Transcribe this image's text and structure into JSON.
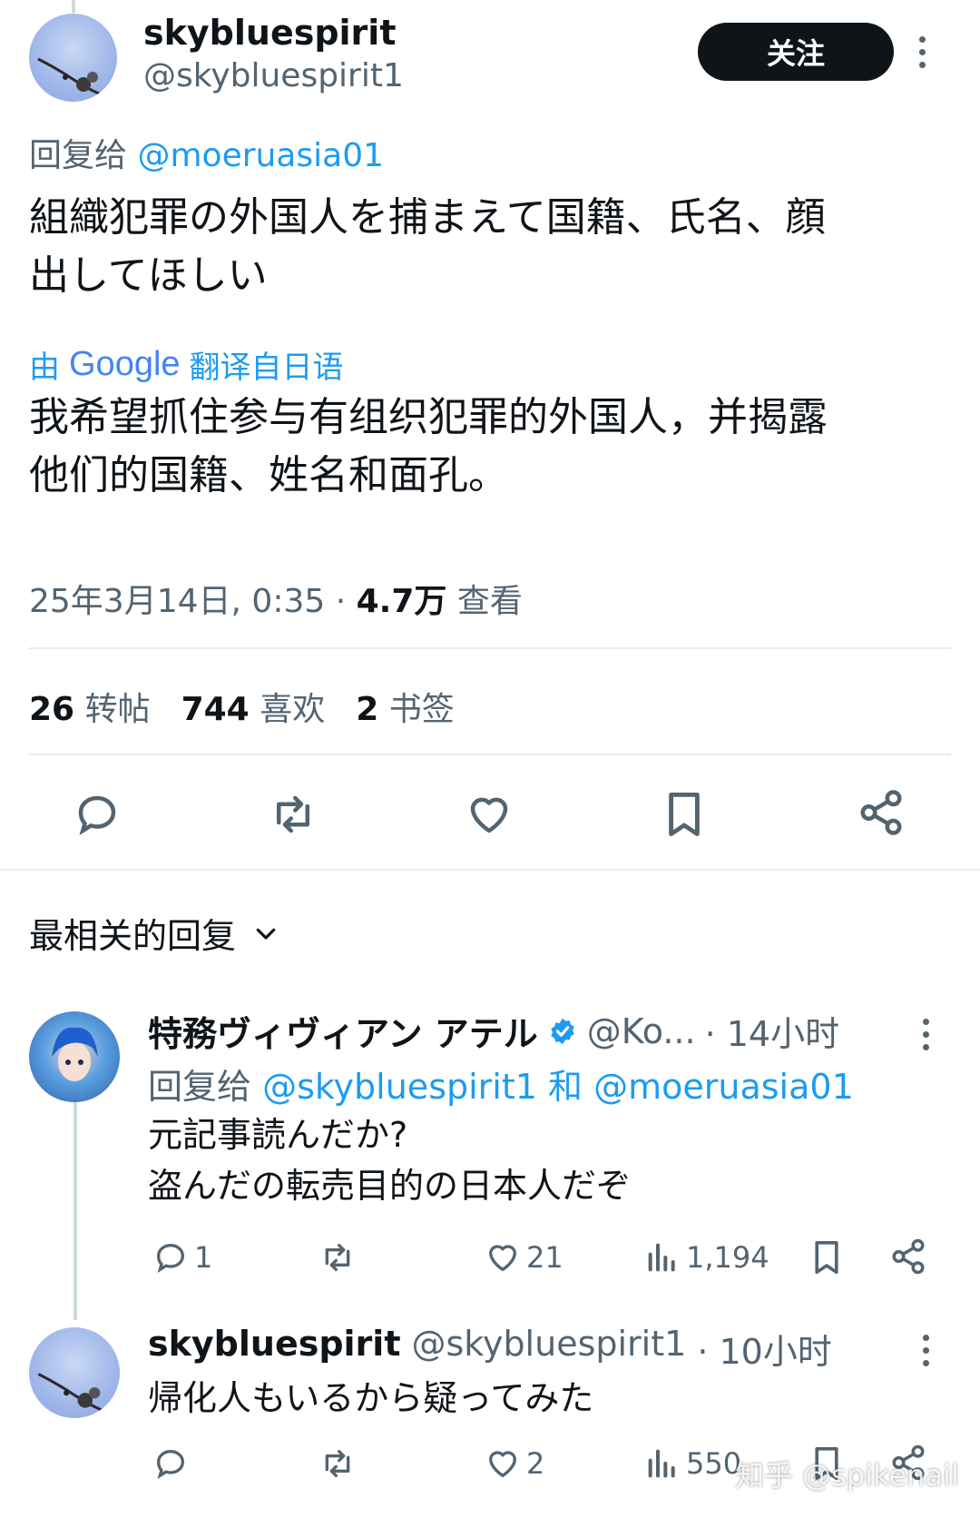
{
  "tweet": {
    "display_name": "skybluespirit",
    "handle": "@skybluespirit1",
    "follow_label": "关注",
    "reply_to_prefix": "回复给",
    "reply_to_handle": "@moeruasia01",
    "text_line1": "組織犯罪の外国人を捕まえて国籍、氏名、顔",
    "text_line2": "出してほしい",
    "translated_by_prefix": "由",
    "translated_by_brand": "Google",
    "translated_by_suffix": "翻译自日语",
    "translation_line1": "我希望抓住参与有组织犯罪的外国人，并揭露",
    "translation_line2": "他们的国籍、姓名和面孔。",
    "timestamp": "25年3月14日, 0:35 · ",
    "views_count": "4.7万",
    "views_label": " 查看",
    "stats": {
      "retweets_count": "26",
      "retweets_label": "转帖",
      "likes_count": "744",
      "likes_label": "喜欢",
      "bookmarks_count": "2",
      "bookmarks_label": "书签"
    }
  },
  "replies_header": {
    "label": "最相关的回复"
  },
  "replies": [
    {
      "display_name": "特務ヴィヴィアン アテル",
      "handle": "@Ko...",
      "time": "· 14小时",
      "reply_to_prefix": "回复给",
      "reply_to_handle_1": "@skybluespirit1",
      "reply_to_and": "和",
      "reply_to_handle_2": "@moeruasia01",
      "text_line1": "元記事読んだか?",
      "text_line2": "盗んだの転売目的の日本人だぞ",
      "reply_count": "1",
      "retweet_count": "",
      "like_count": "21",
      "view_count": "1,194"
    },
    {
      "display_name": "skybluespirit",
      "handle": "@skybluespirit1",
      "time": "· 10小时",
      "text_line1": "帰化人もいるから疑ってみた",
      "reply_count": "",
      "retweet_count": "",
      "like_count": "2",
      "view_count": "550"
    }
  ],
  "watermark": "知乎 @spikenail"
}
